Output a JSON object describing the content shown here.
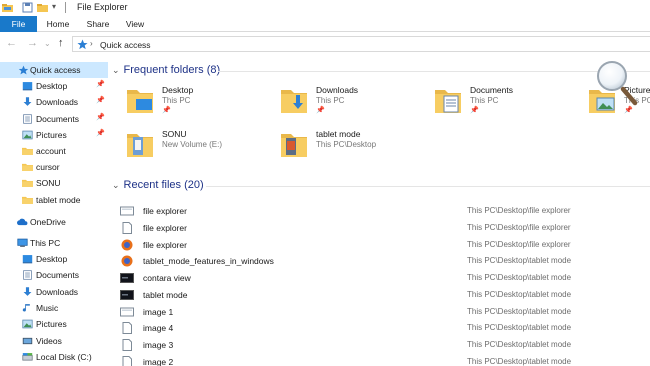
{
  "window": {
    "title": "File Explorer"
  },
  "ribbon": {
    "tabs": [
      "File",
      "Home",
      "Share",
      "View"
    ]
  },
  "address": {
    "path": "Quick access"
  },
  "sidebar": {
    "items": [
      {
        "label": "Quick access",
        "icon": "star-icon",
        "pinned": false
      },
      {
        "label": "Desktop",
        "icon": "desktop-icon",
        "pinned": true
      },
      {
        "label": "Downloads",
        "icon": "download-icon",
        "pinned": true
      },
      {
        "label": "Documents",
        "icon": "documents-icon",
        "pinned": true
      },
      {
        "label": "Pictures",
        "icon": "pictures-icon",
        "pinned": true
      },
      {
        "label": "account",
        "icon": "folder-icon",
        "pinned": false
      },
      {
        "label": "cursor",
        "icon": "folder-icon",
        "pinned": false
      },
      {
        "label": "SONU",
        "icon": "folder-icon",
        "pinned": false
      },
      {
        "label": "tablet mode",
        "icon": "folder-icon",
        "pinned": false
      },
      {
        "label": "OneDrive",
        "icon": "cloud-icon",
        "pinned": false
      },
      {
        "label": "This PC",
        "icon": "computer-icon",
        "pinned": false
      },
      {
        "label": "Desktop",
        "icon": "desktop-icon",
        "pinned": false
      },
      {
        "label": "Documents",
        "icon": "documents-icon",
        "pinned": false
      },
      {
        "label": "Downloads",
        "icon": "download-icon",
        "pinned": false
      },
      {
        "label": "Music",
        "icon": "music-icon",
        "pinned": false
      },
      {
        "label": "Pictures",
        "icon": "pictures-icon",
        "pinned": false
      },
      {
        "label": "Videos",
        "icon": "videos-icon",
        "pinned": false
      },
      {
        "label": "Local Disk (C:)",
        "icon": "disk-icon",
        "pinned": false
      }
    ]
  },
  "frequent": {
    "heading": "Frequent folders (8)",
    "folders": [
      {
        "name": "Desktop",
        "sub": "This PC"
      },
      {
        "name": "Downloads",
        "sub": "This PC"
      },
      {
        "name": "Documents",
        "sub": "This PC"
      },
      {
        "name": "Pictures",
        "sub": "This PC"
      },
      {
        "name": "SONU",
        "sub": "New Volume (E:)"
      },
      {
        "name": "tablet mode",
        "sub": "This PC\\Desktop"
      }
    ]
  },
  "recent": {
    "heading": "Recent files (20)",
    "files": [
      {
        "name": "file explorer",
        "path": "This PC\\Desktop\\file explorer",
        "icon": "image-file-icon"
      },
      {
        "name": "file explorer",
        "path": "This PC\\Desktop\\file explorer",
        "icon": "text-file-icon"
      },
      {
        "name": "file explorer",
        "path": "This PC\\Desktop\\file explorer",
        "icon": "firefox-icon"
      },
      {
        "name": "tablet_mode_features_in_windows",
        "path": "This PC\\Desktop\\tablet mode",
        "icon": "firefox-icon"
      },
      {
        "name": "contara view",
        "path": "This PC\\Desktop\\tablet mode",
        "icon": "screenshot-icon"
      },
      {
        "name": "tablet mode",
        "path": "This PC\\Desktop\\tablet mode",
        "icon": "screenshot-icon"
      },
      {
        "name": "image 1",
        "path": "This PC\\Desktop\\tablet mode",
        "icon": "image-file-icon"
      },
      {
        "name": "image 4",
        "path": "This PC\\Desktop\\tablet mode",
        "icon": "text-file-icon"
      },
      {
        "name": "image 3",
        "path": "This PC\\Desktop\\tablet mode",
        "icon": "text-file-icon"
      },
      {
        "name": "image 2",
        "path": "This PC\\Desktop\\tablet mode",
        "icon": "text-file-icon"
      }
    ]
  },
  "colors": {
    "accent": "#1979ca",
    "selection": "#cce8ff",
    "heading": "#1e3287",
    "folder": "#f5c652"
  }
}
